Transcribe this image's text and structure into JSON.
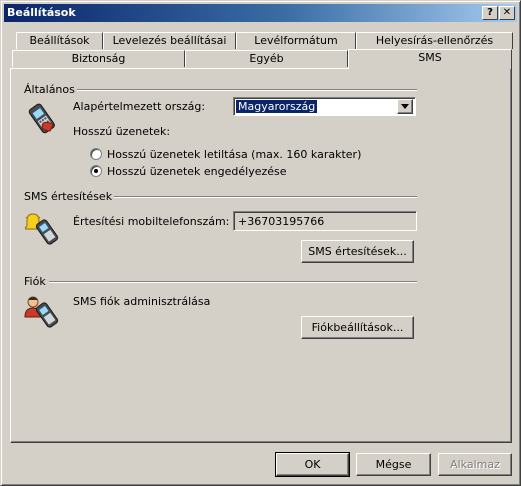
{
  "window": {
    "title": "Beállítások",
    "help_label": "?",
    "close_label": "✕"
  },
  "tabs": {
    "row1": [
      "Beállítások",
      "Levelezés beállításai",
      "Levélformátum",
      "Helyesírás-ellenőrzés"
    ],
    "row2": [
      "Biztonság",
      "Egyéb",
      "SMS"
    ],
    "active": "SMS"
  },
  "general": {
    "header": "Általános",
    "country_label": "Alapértelmezett ország:",
    "country_value": "Magyarország",
    "long_messages_label": "Hosszú üzenetek:",
    "option1": "Hosszú üzenetek letiltása (max. 160 karakter)",
    "option2": "Hosszú üzenetek engedélyezése",
    "selected_option": 2
  },
  "notifications": {
    "header": "SMS értesítések",
    "phone_label": "Értesítési mobiltelefonszám:",
    "phone_value": "+36703195766",
    "button": "SMS értesítések..."
  },
  "account": {
    "header": "Fiók",
    "description": "SMS fiók adminisztrálása",
    "button": "Fiókbeállítások..."
  },
  "footer": {
    "ok": "OK",
    "cancel": "Mégse",
    "apply": "Alkalmaz"
  },
  "icons": [
    "mobile-phone-icon",
    "bell-phone-icon",
    "user-phone-icon"
  ]
}
